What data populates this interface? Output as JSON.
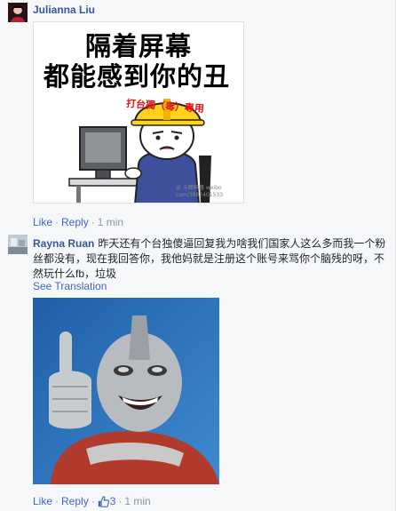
{
  "comments": [
    {
      "author": "Julianna Liu",
      "sticker": {
        "line1": "隔着屏幕",
        "line2": "都能感到你的丑",
        "badge": "打台獨（毒）專用"
      },
      "actions": {
        "like": "Like",
        "reply": "Reply",
        "separator": "·",
        "time": "1 min"
      }
    },
    {
      "author": "Rayna Ruan",
      "text": "昨天还有个台独傻逼回复我为啥我们国家人这么多而我一个粉丝都没有，现在我回答你，我他妈就是注册这个账号来骂你个脑残的呀，不然玩什么fb，垃圾",
      "see_translation": "See Translation",
      "actions": {
        "like": "Like",
        "reply": "Reply",
        "separator": "·",
        "like_count": "3",
        "time": "1 min"
      }
    }
  ],
  "icons": {
    "thumbs_up": "thumbs-up-icon"
  },
  "colors": {
    "link": "#4267b2",
    "author": "#365899",
    "meta": "#90949c",
    "background": "#f6f7f9"
  }
}
